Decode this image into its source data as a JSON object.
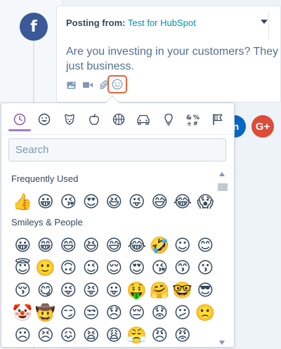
{
  "post": {
    "posting_from_label": "Posting from:",
    "account_name": "Test for HubSpot",
    "text": "Are you investing in your customers? They just business.",
    "network_glyph": "f"
  },
  "toolbar": {
    "icons": [
      "image-icon",
      "video-icon",
      "attachment-icon",
      "emoji-icon"
    ]
  },
  "social": {
    "linkedin_glyph": "in",
    "googleplus_glyph": "G+"
  },
  "emoji_picker": {
    "search_placeholder": "Search",
    "categories": [
      "recent",
      "smileys",
      "animals",
      "food",
      "activity",
      "travel",
      "objects",
      "symbols",
      "flags"
    ],
    "active_category": "recent",
    "sections": [
      {
        "title": "Frequently Used",
        "emojis": [
          "👍",
          "😀",
          "😘",
          "😍",
          "😆",
          "😜",
          "😅",
          "😂",
          "😱"
        ]
      },
      {
        "title": "Smileys & People",
        "emojis": [
          "😀",
          "😁",
          "😄",
          "😆",
          "😅",
          "😂",
          "🤣",
          "☺",
          "😊",
          "😇",
          "🙂",
          "🙃",
          "😉",
          "😌",
          "😍",
          "😘",
          "😙",
          "😗",
          "😚",
          "😋",
          "😜",
          "😝",
          "😛",
          "🤑",
          "🤗",
          "🤓",
          "😎",
          "🤡",
          "🤠",
          "😏",
          "😒",
          "😞",
          "😔",
          "😟",
          "😕",
          "🙁",
          "☹",
          "😣",
          "😖",
          "😫",
          "😩",
          "😤",
          "😠",
          "😡"
        ]
      }
    ]
  },
  "colors": {
    "accent": "#e8613a",
    "facebook": "#3b5998",
    "linkedin": "#0a66c2",
    "googleplus": "#dd4b39",
    "link": "#0091ae"
  }
}
